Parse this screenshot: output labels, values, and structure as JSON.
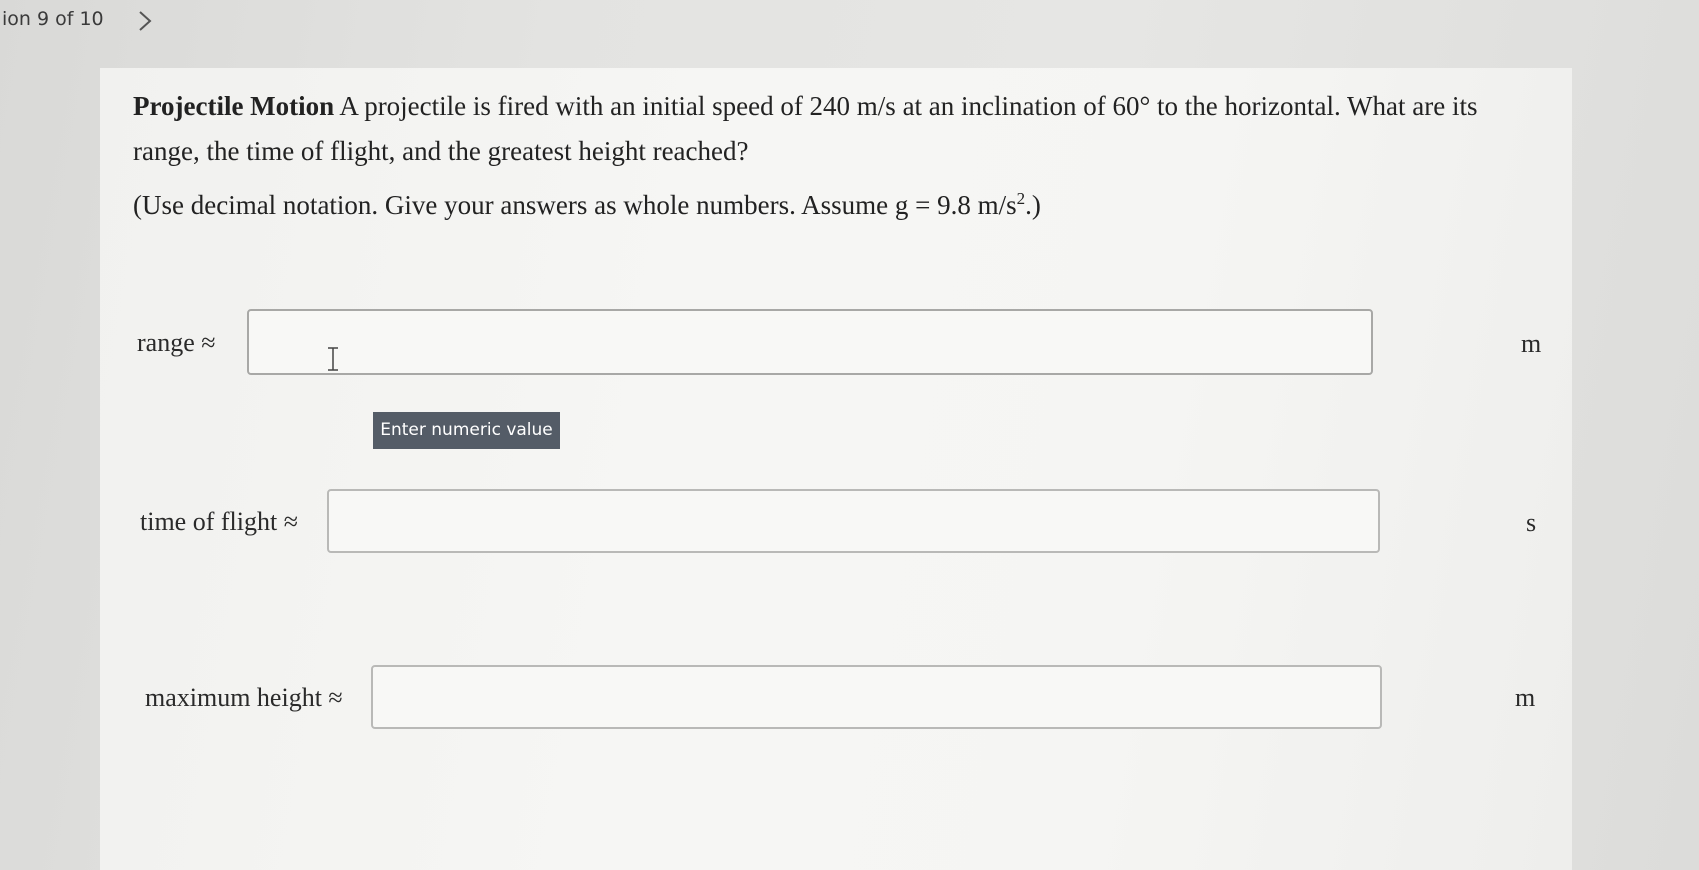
{
  "header": {
    "question_counter": "ion 9 of 10",
    "next_icon": "chevron-right-icon"
  },
  "problem": {
    "title": "Projectile Motion",
    "text": " A projectile is fired with an initial speed of 240 m/s at an inclination of 60° to the horizontal. What are its range, the time of flight, and the greatest height reached?",
    "note_prefix": "(Use decimal notation. Give your answers as whole numbers. Assume ",
    "note_math": "g = 9.8 m/s",
    "note_exponent": "2",
    "note_suffix": ".)"
  },
  "answers": [
    {
      "label": "range ≈",
      "value": "",
      "unit": "m"
    },
    {
      "label": "time of flight ≈",
      "value": "",
      "unit": "s"
    },
    {
      "label": "maximum height ≈",
      "value": "",
      "unit": "m"
    }
  ],
  "tooltip": {
    "text": "Enter numeric value"
  },
  "colors": {
    "tooltip_bg": "#545c67",
    "input_border": "#b9b9b7"
  }
}
